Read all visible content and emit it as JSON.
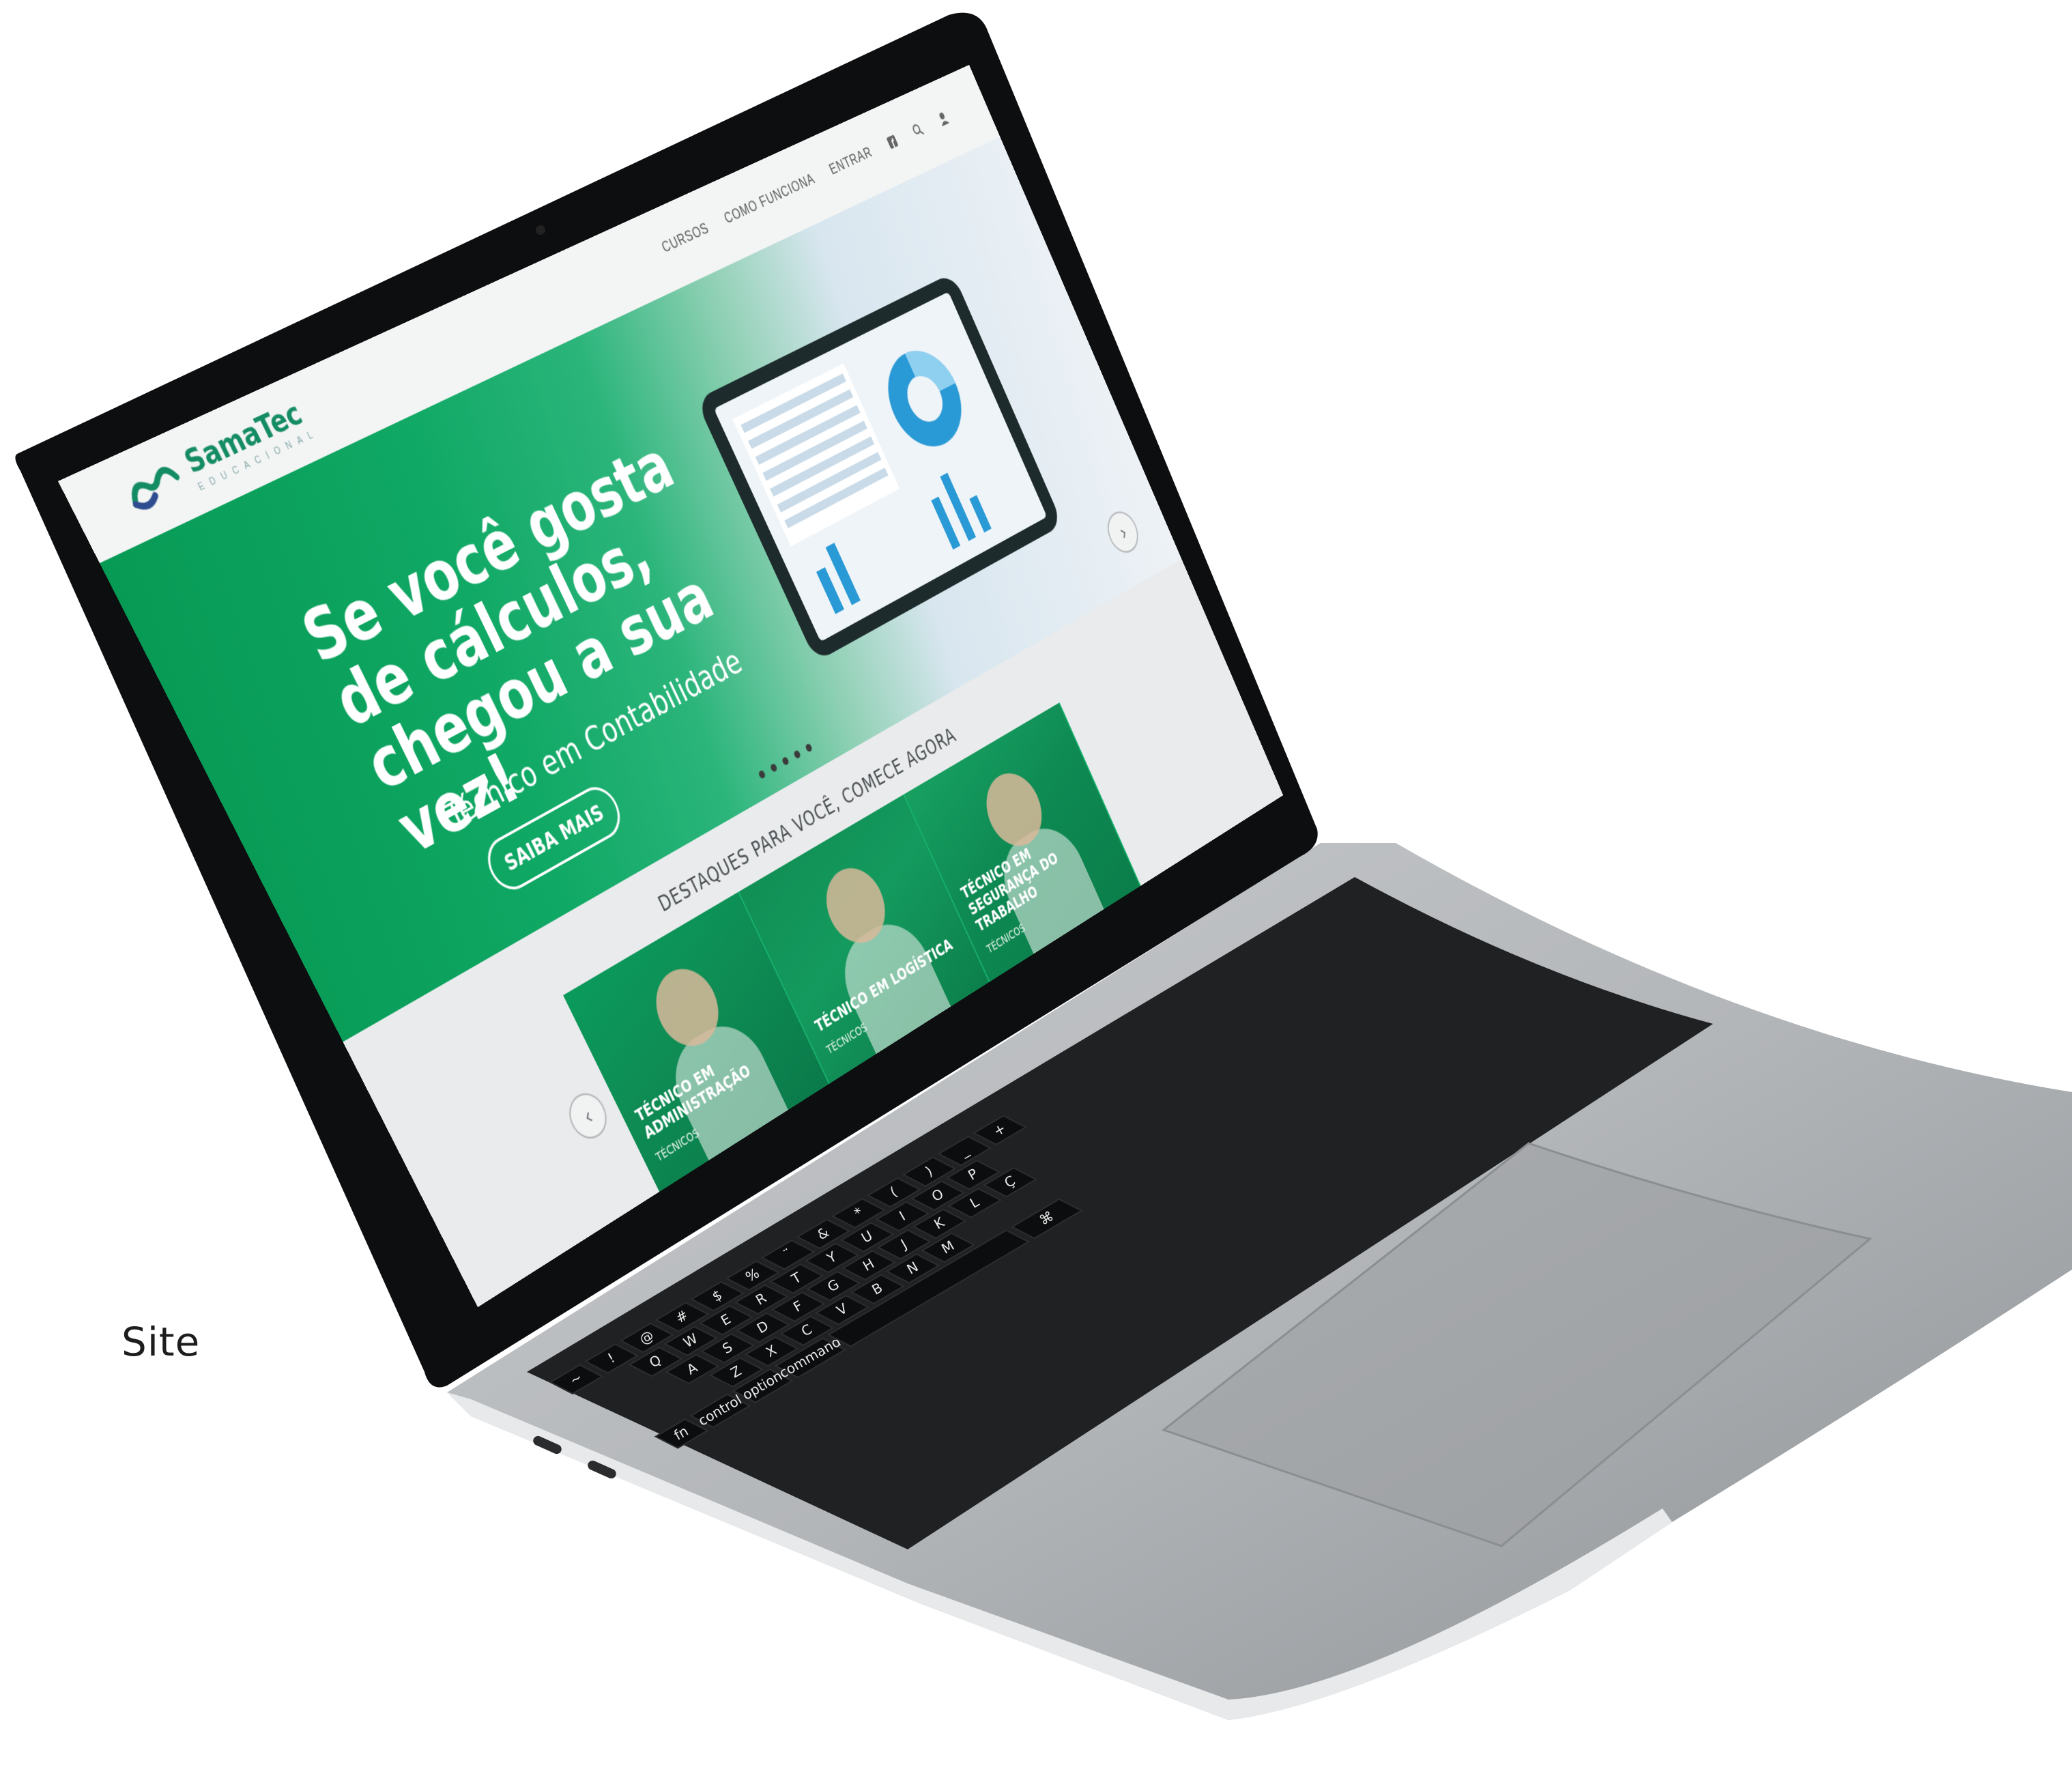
{
  "caption": "Site",
  "site": {
    "brand": {
      "name": "SamaTec",
      "tagline": "EDUCACIONAL"
    },
    "nav": {
      "items": [
        "CURSOS",
        "COMO FUNCIONA",
        "ENTRAR"
      ]
    },
    "hero": {
      "headline_lines": [
        "Se você gosta",
        "de cálculos,",
        "chegou a sua vez!"
      ],
      "subtitle": "Técnico em Contabilidade",
      "cta": "SAIBA MAIS"
    },
    "section_title": "DESTAQUES PARA VOCÊ, COMECE AGORA",
    "cards": [
      {
        "title": "TÉCNICO EM ADMINISTRAÇÃO",
        "tag": "TÉCNICOS"
      },
      {
        "title": "TÉCNICO EM LOGÍSTICA",
        "tag": "TÉCNICOS"
      },
      {
        "title": "TÉCNICO EM SEGURANÇA DO TRABALHO",
        "tag": "TÉCNICOS"
      }
    ],
    "slider": {
      "slides": 5,
      "active": 1,
      "prev_symbol": "‹",
      "next_symbol": "›"
    }
  },
  "keyboard": {
    "number_row": [
      "~",
      "!",
      "@",
      "#",
      "$",
      "%",
      "¨",
      "&",
      "*",
      "(",
      ")",
      "_",
      "+"
    ],
    "row_q": [
      "Q",
      "W",
      "E",
      "R",
      "T",
      "Y",
      "U",
      "I",
      "O",
      "P"
    ],
    "row_a": [
      "A",
      "S",
      "D",
      "F",
      "G",
      "H",
      "J",
      "K",
      "L",
      "Ç"
    ],
    "row_z": [
      "Z",
      "X",
      "C",
      "V",
      "B",
      "N",
      "M"
    ],
    "mods": {
      "fn": "fn",
      "control": "control",
      "option": "option",
      "command": "command",
      "command_symbol": "⌘"
    }
  },
  "colors": {
    "brand_green": "#0fa864",
    "laptop_silver": "#b9bcbf",
    "bezel": "#0d0e10"
  }
}
